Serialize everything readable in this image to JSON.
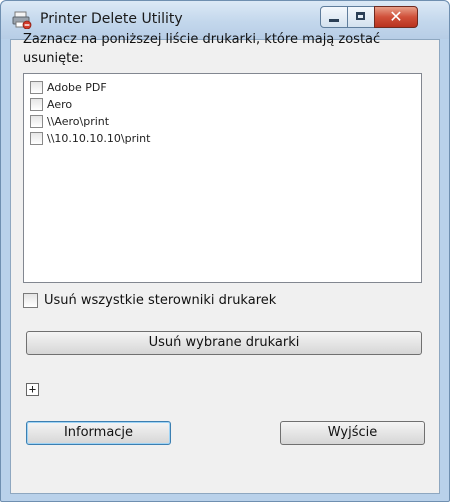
{
  "window": {
    "title": "Printer Delete Utility",
    "app_icon": "printer-delete-icon",
    "controls": {
      "minimize_icon": "minimize-icon",
      "maximize_icon": "maximize-icon",
      "close_icon": "close-icon",
      "close_glyph": "✕"
    }
  },
  "instruction": "Zaznacz na poniższej liście drukarki, które mają zostać usunięte:",
  "printers": [
    {
      "label": "Adobe PDF",
      "checked": false
    },
    {
      "label": "Aero",
      "checked": false
    },
    {
      "label": "\\\\Aero\\print",
      "checked": false
    },
    {
      "label": "\\\\10.10.10.10\\print",
      "checked": false
    }
  ],
  "remove_drivers": {
    "label": "Usuń wszystkie sterowniki drukarek",
    "checked": false
  },
  "delete_button": "Usuń wybrane drukarki",
  "expand_glyph": "+",
  "info_button": "Informacje",
  "exit_button": "Wyjście",
  "colors": {
    "titlebar": "#c3d7ec",
    "close_button": "#d0503a",
    "client_bg": "#f0f0f0",
    "focus_border": "#3c7fb1"
  }
}
